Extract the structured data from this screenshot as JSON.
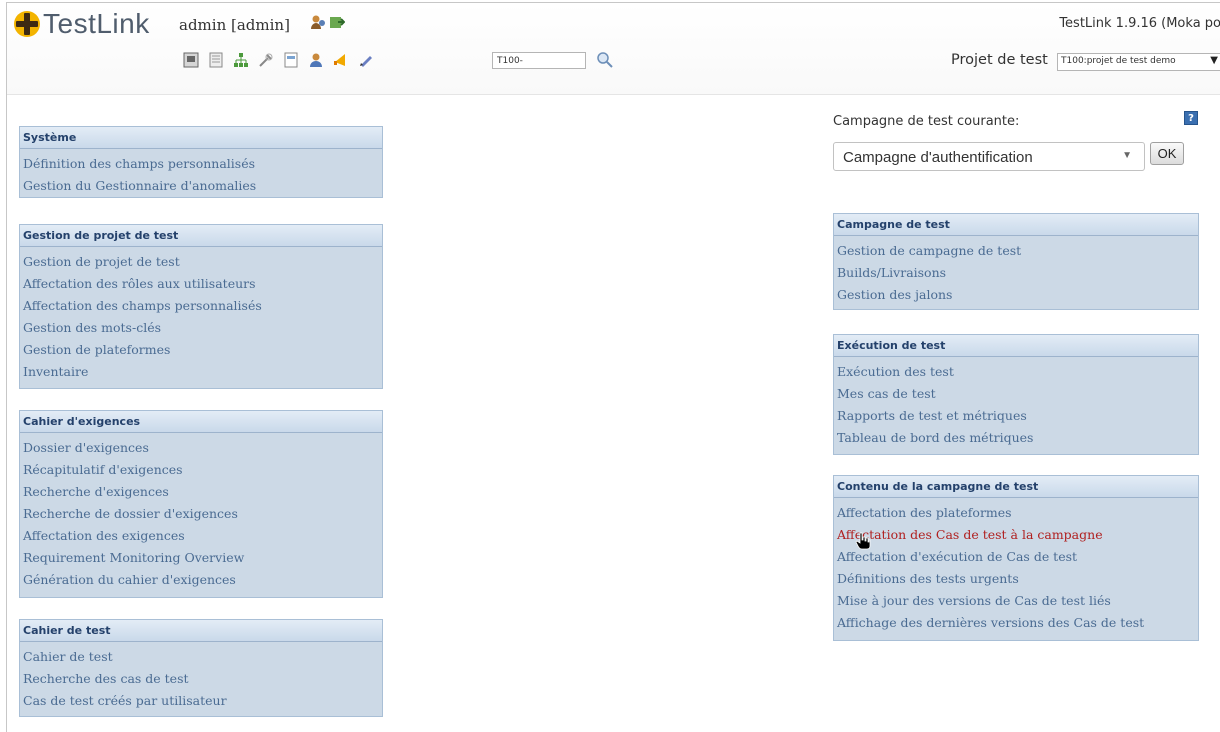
{
  "header": {
    "logo_text": "TestLink",
    "user_label": "admin [admin]",
    "version": "TestLink 1.9.16 (Moka po",
    "search_value": "T100-",
    "project_label": "Projet de test",
    "project_value": "T100:projet de test demo",
    "toolbar_icons": [
      "desktop-icon",
      "requirements-icon",
      "hierarchy-icon",
      "tools-icon",
      "document-icon",
      "user-icon",
      "events-icon",
      "edit-icon"
    ]
  },
  "left_panels": [
    {
      "title": "Système",
      "links": [
        "Définition des champs personnalisés",
        "Gestion du Gestionnaire d'anomalies"
      ]
    },
    {
      "title": "Gestion de projet de test",
      "links": [
        "Gestion de projet de test",
        "Affectation des rôles aux utilisateurs",
        "Affectation des champs personnalisés",
        "Gestion des mots-clés",
        "Gestion de plateformes",
        "Inventaire"
      ]
    },
    {
      "title": "Cahier d'exigences",
      "links": [
        "Dossier d'exigences",
        "Récapitulatif d'exigences",
        "Recherche d'exigences",
        "Recherche de dossier d'exigences",
        "Affectation des exigences",
        "Requirement Monitoring Overview",
        "Génération du cahier d'exigences"
      ]
    },
    {
      "title": "Cahier de test",
      "links": [
        "Cahier de test",
        "Recherche des cas de test",
        "Cas de test créés par utilisateur"
      ]
    }
  ],
  "campaign": {
    "label": "Campagne de test courante:",
    "help": "?",
    "selected": "Campagne d'authentification",
    "ok_label": "OK"
  },
  "right_panels": [
    {
      "title": "Campagne de test",
      "links": [
        "Gestion de campagne de test",
        "Builds/Livraisons",
        "Gestion des jalons"
      ]
    },
    {
      "title": "Exécution de test",
      "links": [
        "Exécution des test",
        "Mes cas de test",
        "Rapports de test et métriques",
        "Tableau de bord des métriques"
      ]
    },
    {
      "title": "Contenu de la campagne de test",
      "links": [
        "Affectation des plateformes",
        "Affectation des Cas de test à la campagne",
        "Affectation d'exécution de Cas de test",
        "Définitions des tests urgents",
        "Mise à jour des versions de Cas de test liés",
        "Affichage des dernières versions des Cas de test"
      ]
    }
  ],
  "colors": {
    "panel_bg": "#ccd9e6",
    "link": "#4a6b92",
    "link_hover": "#b02020",
    "heading": "#24416b"
  }
}
